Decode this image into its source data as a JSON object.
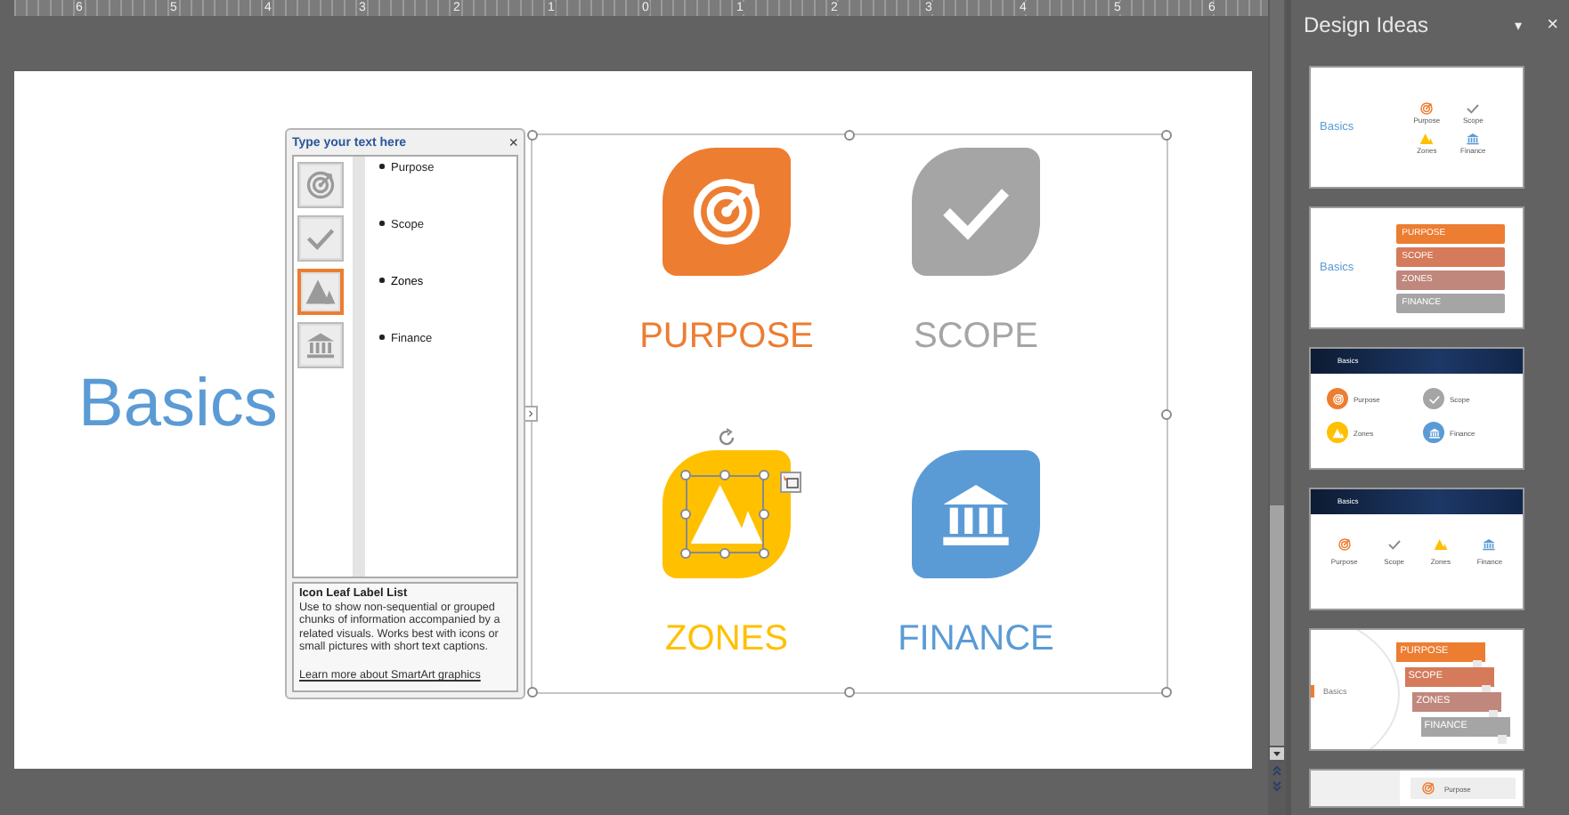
{
  "ruler": {
    "numbers": [
      "6",
      "5",
      "4",
      "3",
      "2",
      "1",
      "0",
      "1",
      "2",
      "3",
      "4",
      "5",
      "6"
    ]
  },
  "slide": {
    "title": "Basics",
    "smartart": {
      "items": [
        {
          "label": "PURPOSE",
          "kind": "target",
          "color": "#ed7d31",
          "selected": false
        },
        {
          "label": "SCOPE",
          "kind": "check",
          "color": "#a5a5a5",
          "selected": false
        },
        {
          "label": "ZONES",
          "kind": "mountain",
          "color": "#ffc000",
          "selected": true
        },
        {
          "label": "FINANCE",
          "kind": "bank",
          "color": "#5b9bd5",
          "selected": false
        }
      ]
    }
  },
  "text_pane": {
    "title": "Type your text here",
    "close": "×",
    "bullets": [
      {
        "text": "Purpose",
        "kind": "target",
        "selected": false
      },
      {
        "text": "Scope",
        "kind": "check",
        "selected": false
      },
      {
        "text": "Zones",
        "kind": "mountain",
        "selected": true
      },
      {
        "text": "Finance",
        "kind": "bank",
        "selected": false
      }
    ],
    "description": {
      "title": "Icon Leaf Label List",
      "body": "Use to show non-sequential or grouped chunks of information accompanied by a related visuals. Works best with icons or small pictures with short text captions.",
      "link": "Learn more about SmartArt graphics"
    }
  },
  "design_ideas": {
    "title": "Design Ideas",
    "menu": "▾",
    "close": "×",
    "thumbnails": [
      {
        "kind": "icons",
        "title": "Basics",
        "items": [
          {
            "label": "Purpose",
            "kind": "target",
            "color": "#ed7d31"
          },
          {
            "label": "Scope",
            "kind": "check",
            "color": "#8c8c8c"
          },
          {
            "label": "Zones",
            "kind": "mountain",
            "color": "#ffc000"
          },
          {
            "label": "Finance",
            "kind": "bank",
            "color": "#5b9bd5"
          }
        ]
      },
      {
        "kind": "bars",
        "title": "Basics",
        "items": [
          {
            "label": "PURPOSE",
            "color": "#ed7d31"
          },
          {
            "label": "SCOPE",
            "color": "#d57a5a"
          },
          {
            "label": "ZONES",
            "color": "#c0877c"
          },
          {
            "label": "FINANCE",
            "color": "#a5a5a5"
          }
        ]
      },
      {
        "kind": "header-circles",
        "title": "Basics",
        "items": [
          {
            "label": "Purpose",
            "kind": "target",
            "color": "#ed7d31"
          },
          {
            "label": "Scope",
            "kind": "check",
            "color": "#a5a5a5"
          },
          {
            "label": "Zones",
            "kind": "mountain",
            "color": "#ffc000"
          },
          {
            "label": "Finance",
            "kind": "bank",
            "color": "#5b9bd5"
          }
        ]
      },
      {
        "kind": "header-icons",
        "title": "Basics",
        "items": [
          {
            "label": "Purpose",
            "kind": "target",
            "color": "#ed7d31"
          },
          {
            "label": "Scope",
            "kind": "check",
            "color": "#8c8c8c"
          },
          {
            "label": "Zones",
            "kind": "mountain",
            "color": "#ffc000"
          },
          {
            "label": "Finance",
            "kind": "bank",
            "color": "#5b9bd5"
          }
        ]
      },
      {
        "kind": "arc-steps",
        "title": "Basics",
        "items": [
          {
            "label": "PURPOSE",
            "color": "#ed7d31"
          },
          {
            "label": "SCOPE",
            "color": "#d57a5a"
          },
          {
            "label": "ZONES",
            "color": "#c0877c"
          },
          {
            "label": "FINANCE",
            "color": "#a5a5a5"
          }
        ]
      },
      {
        "kind": "partial",
        "items": [
          {
            "label": "Purpose",
            "kind": "target",
            "color": "#ed7d31"
          }
        ]
      }
    ]
  }
}
